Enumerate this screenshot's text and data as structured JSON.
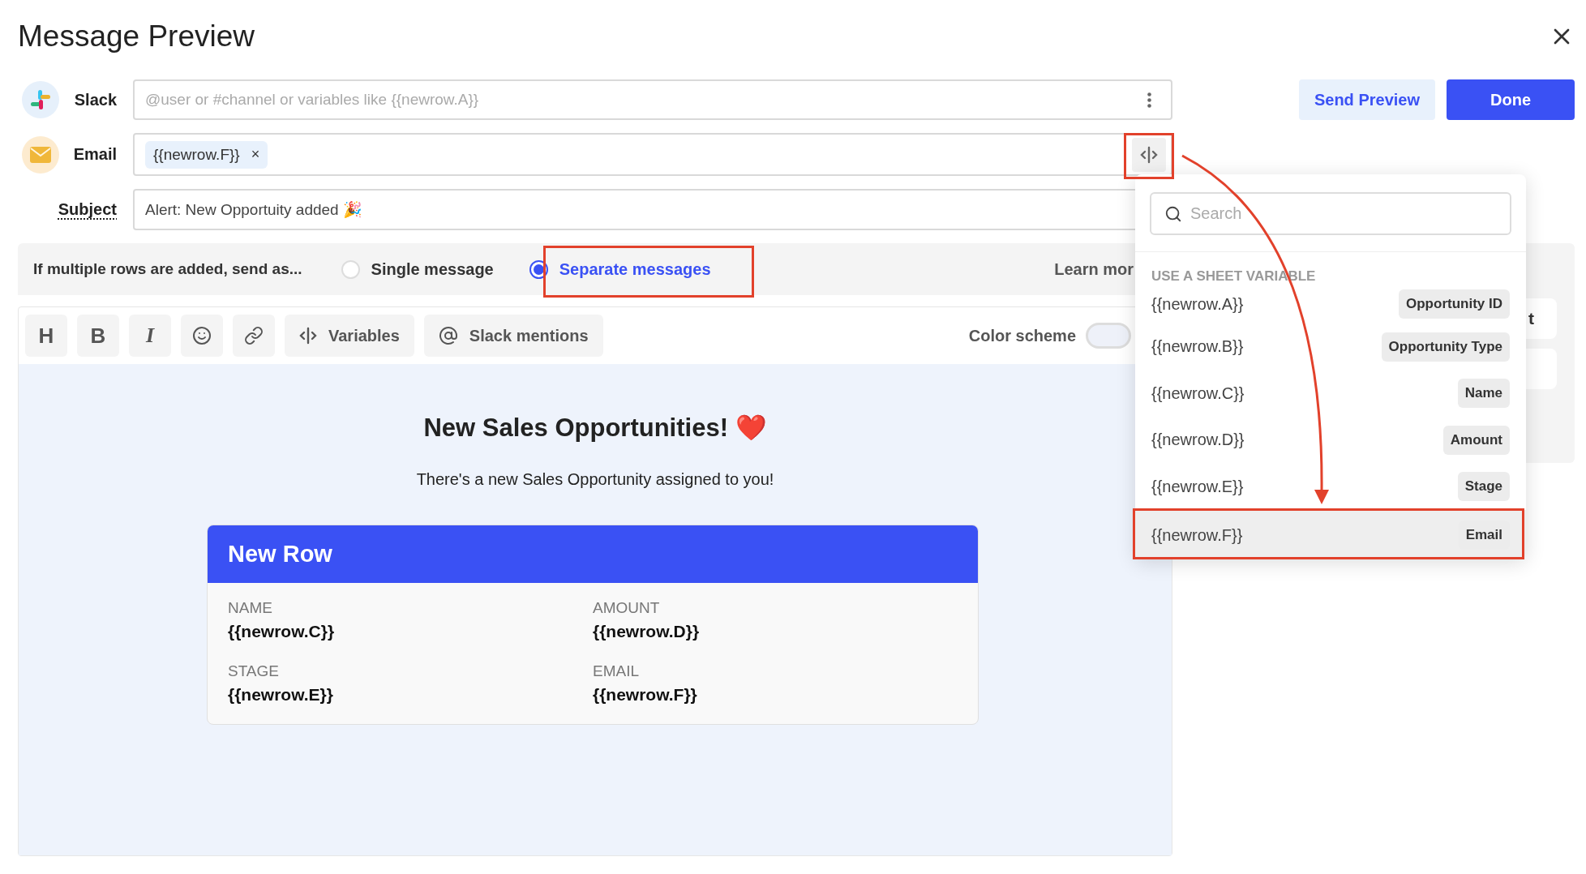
{
  "dialog": {
    "title": "Message Preview"
  },
  "recipients": [
    {
      "kind": "slack",
      "label": "Slack",
      "placeholder": "@user or #channel or variables like {{newrow.A}}"
    },
    {
      "kind": "email",
      "label": "Email",
      "chips": [
        {
          "label": "{{newrow.F}}",
          "remove": "×"
        }
      ]
    }
  ],
  "subject": {
    "label": "Subject",
    "value": "Alert: New Opportuity added 🎉"
  },
  "buttons": [
    {
      "kind": "secondary",
      "label": "Send Preview"
    },
    {
      "kind": "primary",
      "label": "Done"
    }
  ],
  "send_mode": {
    "prompt": "If multiple rows are added, send as...",
    "options": [
      {
        "label": "Single message",
        "selected": false
      },
      {
        "label": "Separate messages",
        "selected": true
      }
    ],
    "link": "Learn mor"
  },
  "toolbar": {
    "tools": [
      {
        "kind": "heading",
        "label": "H"
      },
      {
        "kind": "bold",
        "label": "B"
      },
      {
        "kind": "italic",
        "label": "I"
      },
      {
        "kind": "emoji"
      },
      {
        "kind": "link"
      },
      {
        "kind": "variables",
        "label": "Variables"
      },
      {
        "kind": "mentions",
        "label": "Slack mentions"
      }
    ],
    "color_scheme": {
      "label": "Color scheme",
      "on": false
    }
  },
  "preview": {
    "heading": "New Sales Opportunities! ❤️",
    "subtitle": "There's a new Sales Opportunity assigned to you!",
    "card": {
      "title": "New Row",
      "fields": [
        {
          "label": "NAME",
          "value": "{{newrow.C}}"
        },
        {
          "label": "AMOUNT",
          "value": "{{newrow.D}}"
        },
        {
          "label": "STAGE",
          "value": "{{newrow.E}}"
        },
        {
          "label": "EMAIL",
          "value": "{{newrow.F}}"
        }
      ]
    }
  },
  "side_panel": {
    "buttons": [
      "t"
    ]
  },
  "variable_menu": {
    "search_placeholder": "Search",
    "section": "USE A SHEET VARIABLE",
    "items": [
      {
        "variable": "{{newrow.A}}",
        "column": "Opportunity ID",
        "selected": false
      },
      {
        "variable": "{{newrow.B}}",
        "column": "Opportunity Type",
        "selected": false
      },
      {
        "variable": "{{newrow.C}}",
        "column": "Name",
        "selected": false
      },
      {
        "variable": "{{newrow.D}}",
        "column": "Amount",
        "selected": false
      },
      {
        "variable": "{{newrow.E}}",
        "column": "Stage",
        "selected": false
      },
      {
        "variable": "{{newrow.F}}",
        "column": "Email",
        "selected": true
      }
    ]
  }
}
